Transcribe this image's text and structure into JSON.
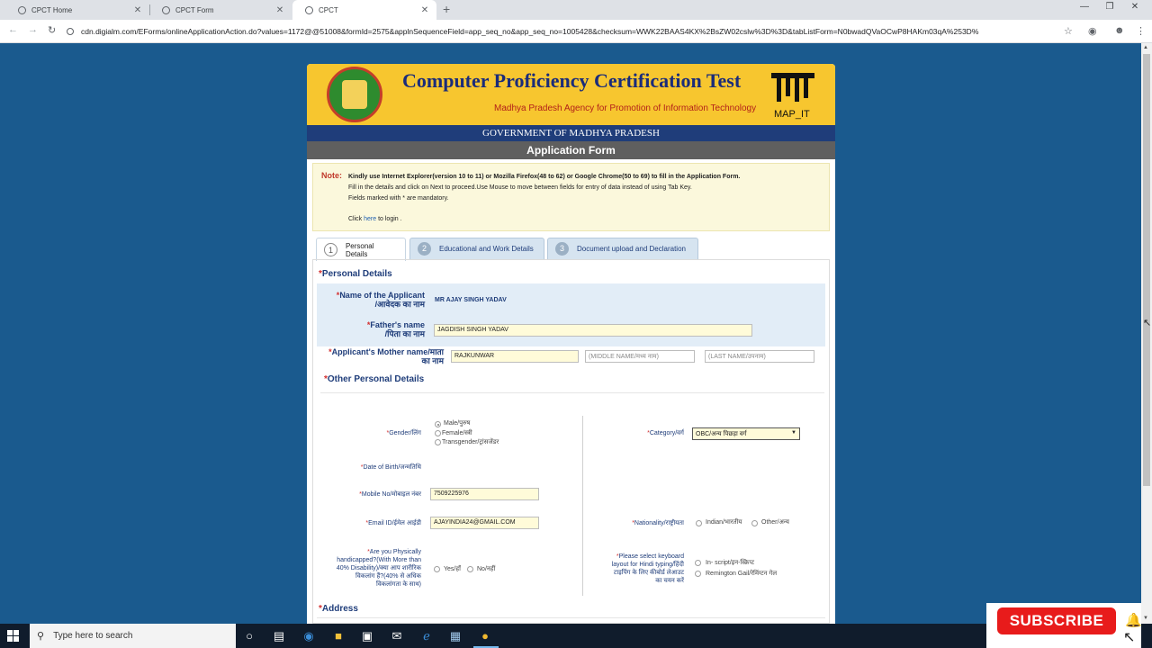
{
  "browser": {
    "tabs": [
      {
        "label": "CPCT Home",
        "active": false
      },
      {
        "label": "CPCT Form",
        "active": false
      },
      {
        "label": "CPCT",
        "active": true
      }
    ],
    "url": "cdn.digialm.com/EForms/onlineApplicationAction.do?values=1172@@51008&formId=2575&applnSequenceField=app_seq_no&app_seq_no=1005428&checksum=WWK22BAAS4KX%2BsZW02cslw%3D%3D&tabListForm=N0bwadQVaOCwP8HAKm03qA%253D%",
    "new_tab": "+",
    "close": "✕"
  },
  "banner": {
    "title": "Computer Proficiency Certification Test",
    "subtitle": "Madhya Pradesh Agency for Promotion of Information Technology",
    "logo_text": "MAP_IT",
    "gov": "GOVERNMENT OF MADHYA PRADESH",
    "form_title": "Application Form"
  },
  "note": {
    "label": "Note:",
    "line1": "Kindly use Internet Explorer(version 10 to 11) or Mozilla Firefox(48 to 62) or Google Chrome(50 to 69) to fill in the Application Form.",
    "line2": "Fill in the details and click on Next to proceed.Use Mouse to move between fields for entry of data instead of using Tab Key.",
    "line3": "Fields marked with * are mandatory.",
    "line4_pre": "Click ",
    "line4_link": "here",
    "line4_post": " to login ."
  },
  "tabs": [
    {
      "num": "1",
      "label": "Personal Details"
    },
    {
      "num": "2",
      "label": "Educational and Work Details"
    },
    {
      "num": "3",
      "label": "Document upload and Declaration"
    }
  ],
  "personal": {
    "section": "Personal Details",
    "applicant_label_1": "Name of the Applicant",
    "applicant_label_2": "/आवेदक का नाम",
    "applicant_value": "MR AJAY SINGH YADAV",
    "father_label_1": "Father's name",
    "father_label_2": "/पिता का नाम",
    "father_value": "JAGDISH SINGH YADAV",
    "mother_label_1": "Applicant's Mother name/माता",
    "mother_label_2": "का नाम",
    "mother_first": "RAJKUNWAR",
    "mother_middle_ph": "(MIDDLE NAME/मध्य नाम)",
    "mother_last_ph": "(LAST NAME/उपनाम)"
  },
  "other": {
    "section": "Other Personal Details",
    "gender_label": "Gender/लिंग",
    "gender_options": [
      "Male/पुरुष",
      "Female/स्त्री",
      "Transgender/ट्रांसजेंडर"
    ],
    "category_label": "Category/वर्ग",
    "category_value": "OBC/अन्य पिछड़ा वर्ग",
    "dob_label": "Date of Birth/जन्मतिथि",
    "mobile_label": "Mobile No/मोबाइल नंबर",
    "mobile_value": "7509225976",
    "email_label": "Email ID/ईमेल आईडी",
    "email_value": "AJAYINDIA24@GMAIL.COM",
    "nationality_label": "Nationality/राष्ट्रीयता",
    "nationality_options": [
      "Indian/भारतीय",
      "Other/अन्य"
    ],
    "ph_label_1": "Are you Physically",
    "ph_label_2": "handicapped?(With More than",
    "ph_label_3": "40% Disability)/क्या आप शारीरिक",
    "ph_label_4": "विकलांग हैं?(40% से अधिक",
    "ph_label_5": "विकलांगता के साथ)",
    "ph_options": [
      "Yes/हाँ",
      "No/नहीं"
    ],
    "kb_label_1": "Please select keyboard",
    "kb_label_2": "layout for Hindi typing/हिंदी",
    "kb_label_3": "टाइपिंग के लिए कीबोर्ड लेआउट",
    "kb_label_4": "का चयन करें",
    "kb_options": [
      "In- script/इन-स्क्रिप्ट",
      "Remington Gail/रेमिंग्टन गेल"
    ]
  },
  "address": {
    "section": "Address"
  },
  "taskbar": {
    "search_placeholder": "Type here to search"
  },
  "overlay": {
    "subscribe": "SUBSCRIBE"
  }
}
